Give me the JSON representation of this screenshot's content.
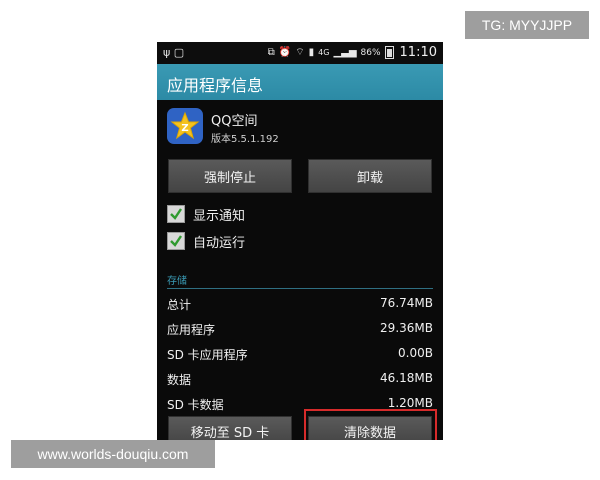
{
  "status_bar": {
    "left_icons": [
      "usb-icon",
      "clipboard-icon"
    ],
    "right_icons": [
      "vibrate-icon",
      "alarm-icon",
      "wifi-icon",
      "sim-icon",
      "signal-icon"
    ],
    "network": "4G",
    "battery": "86%",
    "time": "11:10"
  },
  "header": {
    "title": "应用程序信息"
  },
  "app": {
    "name": "QQ空间",
    "version": "版本5.5.1.192",
    "icon": "qzone-star-icon",
    "icon_color": "#2f63c4"
  },
  "actions": {
    "force_stop": "强制停止",
    "uninstall": "卸载"
  },
  "options": [
    {
      "label": "显示通知",
      "checked": true
    },
    {
      "label": "自动运行",
      "checked": true
    }
  ],
  "storage": {
    "section_title": "存储",
    "rows": [
      {
        "label": "总计",
        "value": "76.74MB"
      },
      {
        "label": "应用程序",
        "value": "29.36MB"
      },
      {
        "label": "SD 卡应用程序",
        "value": "0.00B"
      },
      {
        "label": "数据",
        "value": "46.18MB"
      },
      {
        "label": "SD 卡数据",
        "value": "1.20MB"
      }
    ],
    "move_button": "移动至 SD 卡",
    "clear_button": "清除数据"
  },
  "overlays": {
    "top_right": "TG: MYYJJPP",
    "bottom_left": "www.worlds-douqiu.com"
  },
  "colors": {
    "accent": "#3a9ab4",
    "highlight": "#d62b2b",
    "check": "#2f9a2f"
  }
}
